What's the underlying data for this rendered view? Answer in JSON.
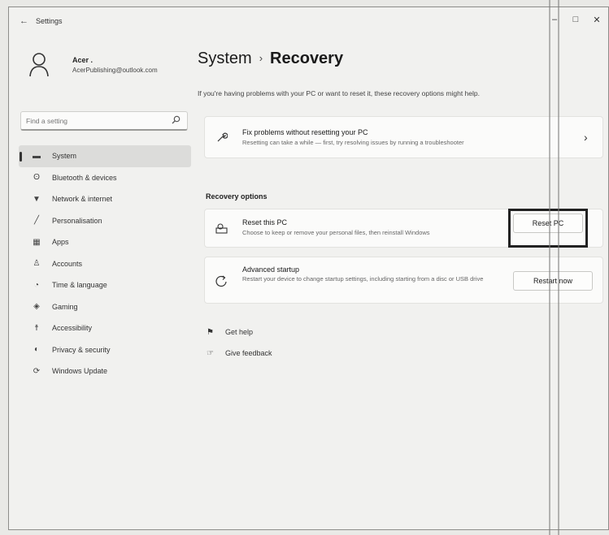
{
  "window": {
    "title": "Settings",
    "back": "←",
    "minimize": "–",
    "maximize": "□",
    "close": "✕"
  },
  "profile": {
    "name": "Acer .",
    "email": "AcerPublishing@outlook.com"
  },
  "search": {
    "placeholder": "Find a setting"
  },
  "sidebar": {
    "items": [
      {
        "label": "System",
        "icon": "monitor-icon",
        "glyph": "▬",
        "active": true
      },
      {
        "label": "Bluetooth & devices",
        "icon": "bluetooth-icon",
        "glyph": "ʘ"
      },
      {
        "label": "Network & internet",
        "icon": "wifi-icon",
        "glyph": "▼"
      },
      {
        "label": "Personalisation",
        "icon": "brush-icon",
        "glyph": "╱"
      },
      {
        "label": "Apps",
        "icon": "apps-icon",
        "glyph": "▦"
      },
      {
        "label": "Accounts",
        "icon": "person-icon",
        "glyph": "♙"
      },
      {
        "label": "Time & language",
        "icon": "globe-clock-icon",
        "glyph": "◔"
      },
      {
        "label": "Gaming",
        "icon": "gamepad-icon",
        "glyph": "◈"
      },
      {
        "label": "Accessibility",
        "icon": "accessibility-icon",
        "glyph": "☨"
      },
      {
        "label": "Privacy & security",
        "icon": "shield-icon",
        "glyph": "◐"
      },
      {
        "label": "Windows Update",
        "icon": "update-icon",
        "glyph": "⟳"
      }
    ]
  },
  "main": {
    "breadcrumb_parent": "System",
    "breadcrumb_sep": "›",
    "breadcrumb_current": "Recovery",
    "intro": "If you're having problems with your PC or want to reset it, these recovery options might help.",
    "fix_card": {
      "title": "Fix problems without resetting your PC",
      "desc": "Resetting can take a while — first, try resolving issues by running a troubleshooter",
      "chevron": "›"
    },
    "section_title": "Recovery options",
    "reset_card": {
      "title": "Reset this PC",
      "desc": "Choose to keep or remove your personal files, then reinstall Windows",
      "button": "Reset PC"
    },
    "advanced_card": {
      "title": "Advanced startup",
      "desc": "Restart your device to change startup settings, including starting from a disc or USB drive",
      "button": "Restart now"
    },
    "links": [
      {
        "label": "Get help",
        "icon": "help-icon",
        "glyph": "⚑"
      },
      {
        "label": "Give feedback",
        "icon": "feedback-icon",
        "glyph": "☞"
      }
    ]
  }
}
